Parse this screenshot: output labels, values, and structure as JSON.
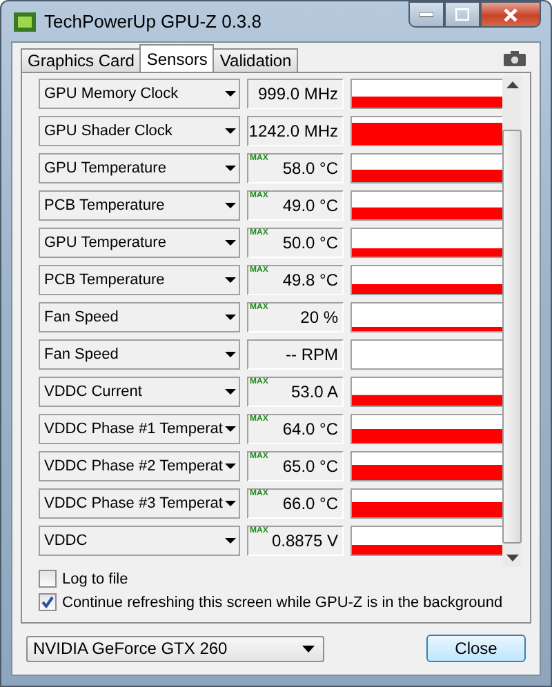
{
  "window": {
    "title": "TechPowerUp GPU-Z 0.3.8"
  },
  "tabs": [
    {
      "label": "Graphics Card",
      "selected": false
    },
    {
      "label": "Sensors",
      "selected": true
    },
    {
      "label": "Validation",
      "selected": false
    }
  ],
  "sensors": [
    {
      "name": "GPU Memory Clock",
      "value": "999.0 MHz"
    },
    {
      "name": "GPU Shader Clock",
      "value": "1242.0 MHz"
    },
    {
      "name": "GPU Temperature",
      "flag": "MAX",
      "value": "58.0 °C"
    },
    {
      "name": "PCB Temperature",
      "flag": "MAX",
      "value": "49.0 °C"
    },
    {
      "name": "GPU Temperature",
      "flag": "MAX",
      "value": "50.0 °C"
    },
    {
      "name": "PCB Temperature",
      "flag": "MAX",
      "value": "49.8 °C"
    },
    {
      "name": "Fan Speed",
      "flag": "MAX",
      "value": "20 %"
    },
    {
      "name": "Fan Speed",
      "value": "-- RPM"
    },
    {
      "name": "VDDC Current",
      "flag": "MAX",
      "value": "53.0 A"
    },
    {
      "name": "VDDC Phase #1 Temperat",
      "flag": "MAX",
      "value": "64.0 °C"
    },
    {
      "name": "VDDC Phase #2 Temperat",
      "flag": "MAX",
      "value": "65.0 °C"
    },
    {
      "name": "VDDC Phase #3 Temperat",
      "flag": "MAX",
      "value": "66.0 °C"
    },
    {
      "name": "VDDC",
      "flag": "MAX",
      "value": "0.8875 V"
    }
  ],
  "options": [
    {
      "label": "Log to file",
      "checked": false
    },
    {
      "label": "Continue refreshing this screen while GPU-Z is in the background",
      "checked": true
    }
  ],
  "card_select": "NVIDIA GeForce GTX 260",
  "close_button": "Close"
}
